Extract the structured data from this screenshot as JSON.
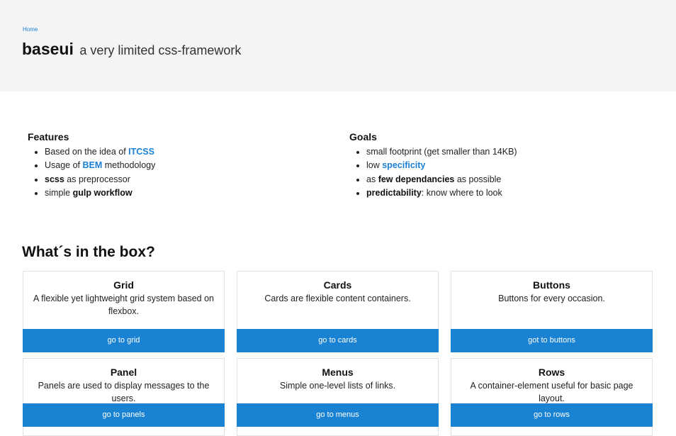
{
  "header": {
    "breadcrumb": "Home",
    "brand_name": "baseui",
    "brand_tagline": "a very limited css-framework"
  },
  "features": {
    "title": "Features",
    "items": [
      {
        "pre": "Based on the idea of ",
        "link": "ITCSS",
        "post": ""
      },
      {
        "pre": "Usage of ",
        "link": "BEM",
        "post": " methodology"
      },
      {
        "bold": "scss",
        "post": " as preprocessor"
      },
      {
        "pre": "simple ",
        "bold": "gulp workflow",
        "post": ""
      }
    ]
  },
  "goals": {
    "title": "Goals",
    "items": [
      {
        "pre": "small footprint (get smaller than 14KB)"
      },
      {
        "pre": "low ",
        "link": "specificity",
        "post": ""
      },
      {
        "pre": "as ",
        "bold": "few dependancies",
        "post": " as possible"
      },
      {
        "bold": "predictability",
        "post": ": know where to look"
      }
    ]
  },
  "box": {
    "title": "What´s in the box?",
    "cards": [
      {
        "title": "Grid",
        "text": "A flexible yet lightweight grid system based on flexbox.",
        "button": "go to grid"
      },
      {
        "title": "Cards",
        "text": "Cards are flexible content containers.",
        "button": "go to cards"
      },
      {
        "title": "Buttons",
        "text": "Buttons for every occasion.",
        "button": "got to buttons"
      },
      {
        "title": "Panel",
        "text": "Panels are used to display messages to the users.",
        "button": "go to panels"
      },
      {
        "title": "Menus",
        "text": "Simple one-level lists of links.",
        "button": "go to menus"
      },
      {
        "title": "Rows",
        "text": "A container-element useful for basic page layout.",
        "button": "go to rows"
      }
    ]
  },
  "colors": {
    "header_bg": "#f4f4f4",
    "accent": "#1a82d2",
    "link": "#1a7fd4"
  }
}
